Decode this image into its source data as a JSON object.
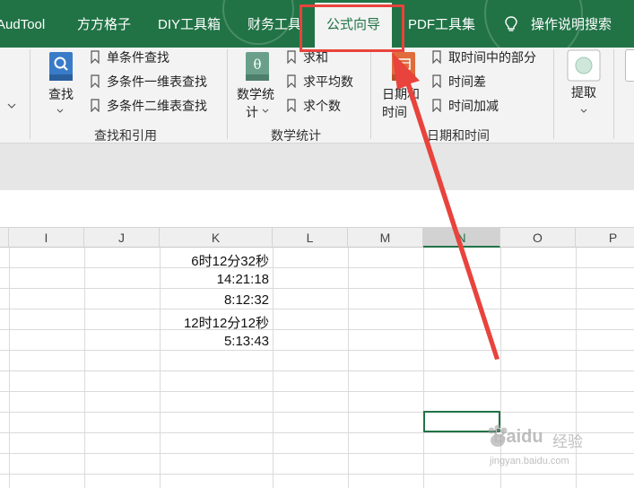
{
  "tabs": {
    "audtool": "AudTool",
    "fangfang": "方方格子",
    "diy": "DIY工具箱",
    "finance": "财务工具",
    "formula": "公式向导",
    "pdf": "PDF工具集",
    "tell_me": "操作说明搜索"
  },
  "ribbon": {
    "lookup": {
      "big_button": "查找",
      "items": [
        "单条件查找",
        "多条件一维表查找",
        "多条件二维表查找"
      ],
      "group_label": "查找和引用"
    },
    "math": {
      "big_button_line1": "数学统",
      "big_button_line2": "计",
      "items": [
        "求和",
        "求平均数",
        "求个数"
      ],
      "group_label": "数学统计"
    },
    "datetime": {
      "big_button_line1": "日期和",
      "big_button_line2": "时间",
      "items": [
        "取时间中的部分",
        "时间差",
        "时间加减"
      ],
      "group_label": "日期和时间"
    },
    "extract": {
      "big_button": "提取"
    }
  },
  "grid": {
    "columns": [
      "I",
      "J",
      "K",
      "L",
      "M",
      "N",
      "O",
      "P"
    ],
    "selected_column": "N",
    "k_values": [
      "6时12分32秒",
      "14:21:18",
      "8:12:32",
      "12时12分12秒",
      "5:13:43"
    ]
  },
  "colors": {
    "excel_green": "#217346",
    "annotation_red": "#e8433c"
  },
  "watermark": {
    "brand": "Baidu",
    "brand_suffix": "经验",
    "url": "jingyan.baidu.com"
  }
}
